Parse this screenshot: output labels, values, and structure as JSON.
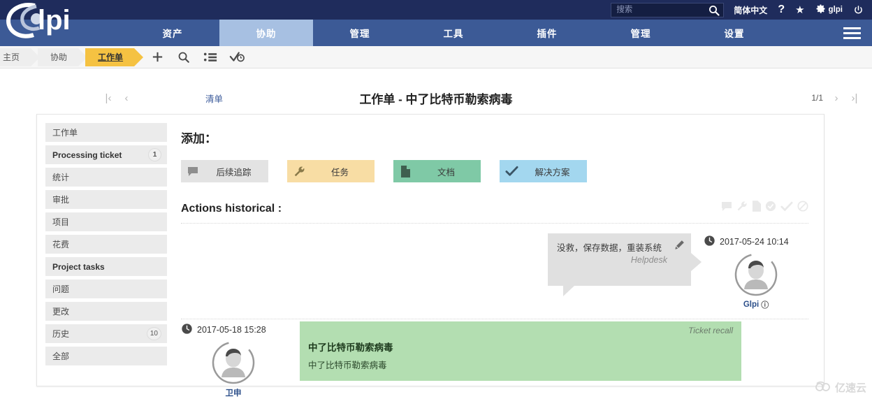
{
  "topbar": {
    "search_placeholder": "搜索",
    "search_value": "",
    "search_icon": "search-icon",
    "language": "简体中文",
    "help_icon": "question-mark-icon",
    "favorite_icon": "star-icon",
    "settings_icon": "gear-icon",
    "settings_label": "glpi",
    "logout_icon": "power-icon"
  },
  "brand": {
    "name": "Glpi"
  },
  "mainnav": {
    "items": [
      {
        "label": "资产",
        "active": false
      },
      {
        "label": "协助",
        "active": true
      },
      {
        "label": "管理",
        "active": false
      },
      {
        "label": "工具",
        "active": false
      },
      {
        "label": "插件",
        "active": false
      },
      {
        "label": "管理",
        "active": false
      },
      {
        "label": "设置",
        "active": false
      }
    ],
    "menu_icon": "hamburger-menu-icon"
  },
  "breadcrumb": {
    "items": [
      {
        "label": "主页",
        "active": false
      },
      {
        "label": "协助",
        "active": false
      },
      {
        "label": "工作单",
        "active": true
      }
    ],
    "actions": [
      {
        "icon": "plus-icon",
        "name": "add-ticket-icon"
      },
      {
        "icon": "search-icon",
        "name": "search-ticket-icon"
      },
      {
        "icon": "list-icon",
        "name": "list-view-icon"
      },
      {
        "icon": "check-clock-icon",
        "name": "validation-icon"
      }
    ]
  },
  "pageheader": {
    "first_arrow": "|‹",
    "prev_arrow": "‹",
    "list_link": "清单",
    "title": "工作单 - 中了比特币勒索病毒",
    "counter": "1/1",
    "next_arrow": "›",
    "last_arrow": "›|"
  },
  "sidebar": {
    "items": [
      {
        "label": "工作单",
        "badge": "",
        "bold": false
      },
      {
        "label": "Processing ticket",
        "badge": "1",
        "bold": true
      },
      {
        "label": "统计",
        "badge": "",
        "bold": false
      },
      {
        "label": "审批",
        "badge": "",
        "bold": false
      },
      {
        "label": "项目",
        "badge": "",
        "bold": false
      },
      {
        "label": "花费",
        "badge": "",
        "bold": false
      },
      {
        "label": "Project tasks",
        "badge": "",
        "bold": true
      },
      {
        "label": "问题",
        "badge": "",
        "bold": false
      },
      {
        "label": "更改",
        "badge": "",
        "bold": false
      },
      {
        "label": "历史",
        "badge": "10",
        "bold": false
      },
      {
        "label": "全部",
        "badge": "",
        "bold": false
      }
    ]
  },
  "add_section": {
    "title": "添加：",
    "buttons": [
      {
        "label": "后续追踪",
        "icon": "chat-bubble-icon",
        "color": "#e3e3e3"
      },
      {
        "label": "任务",
        "icon": "wrench-icon",
        "color": "#f8dda4"
      },
      {
        "label": "文档",
        "icon": "document-icon",
        "color": "#7fc9a6"
      },
      {
        "label": "解决方案",
        "icon": "checkmark-icon",
        "color": "#a3d7ef"
      }
    ]
  },
  "history": {
    "title": "Actions historical :",
    "filters": [
      {
        "name": "filter-followup-icon"
      },
      {
        "name": "filter-task-icon"
      },
      {
        "name": "filter-document-icon"
      },
      {
        "name": "filter-validation-icon"
      },
      {
        "name": "filter-solution-icon"
      },
      {
        "name": "filter-none-icon"
      }
    ],
    "entries": [
      {
        "side": "right",
        "timestamp": "2017-05-24 10:14",
        "user": "Glpi",
        "message": "没救，保存数据，重装系统",
        "source": "Helpdesk",
        "edit_icon": "pencil-icon"
      },
      {
        "side": "left",
        "timestamp": "2017-05-18 15:28",
        "user": "卫申",
        "tag": "Ticket recall",
        "title": "中了比特币勒索病毒",
        "body": "中了比特币勒索病毒"
      }
    ]
  },
  "watermark": {
    "label": "亿速云",
    "icon": "cloud-icon"
  }
}
